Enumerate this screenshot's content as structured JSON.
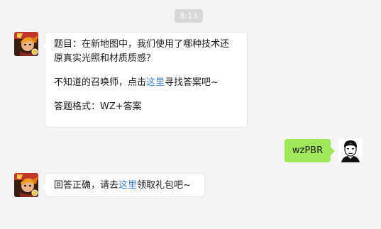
{
  "chat": {
    "timestamp": "8:13",
    "messages": [
      {
        "sender": "game-account",
        "question_prefix": "题目：在新地图中，我们使用了哪种技术还",
        "question_suffix": "原真实光照和材质质感？",
        "hint_prefix": "不知道的召唤师，点击",
        "hint_link": "这里",
        "hint_suffix": "寻找答案吧~",
        "format_text": "答题格式：WZ+答案"
      },
      {
        "sender": "user",
        "text": "wzPBR"
      },
      {
        "sender": "game-account",
        "reply_prefix": "回答正确，请去",
        "reply_link": "这里",
        "reply_suffix": "领取礼包吧~"
      }
    ]
  },
  "colors": {
    "background": "#f4f4f4",
    "incoming_bubble": "#ffffff",
    "outgoing_bubble": "#a0e75a",
    "link": "#3b7fd6",
    "timestamp_bg": "#d7d7d7"
  },
  "icons": {
    "game_avatar": "game-hero-avatar-icon",
    "user_avatar": "cartoon-man-avatar-icon"
  }
}
